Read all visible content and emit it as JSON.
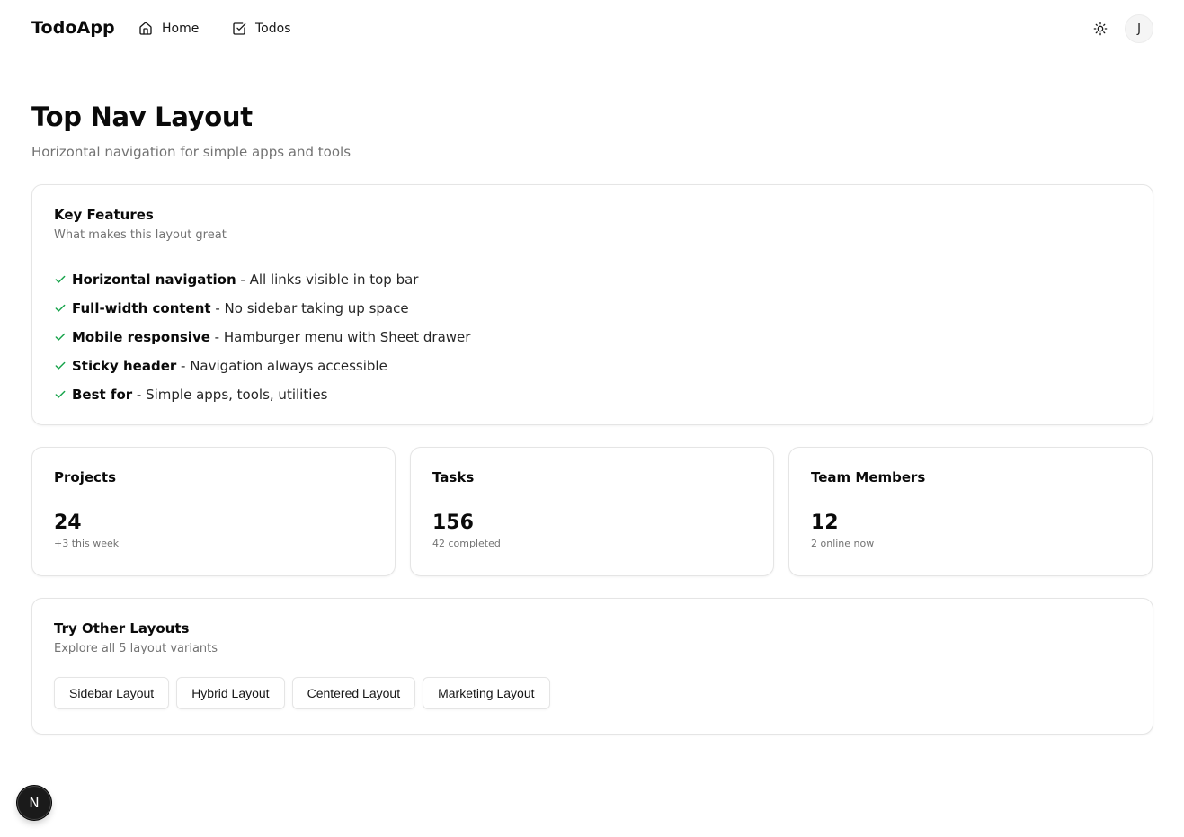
{
  "header": {
    "brand": "TodoApp",
    "nav": [
      {
        "label": "Home",
        "icon": "home-icon"
      },
      {
        "label": "Todos",
        "icon": "checkbox-icon"
      }
    ],
    "theme_icon": "sun-icon",
    "avatar_initial": "J"
  },
  "page": {
    "title": "Top Nav Layout",
    "subtitle": "Horizontal navigation for simple apps and tools"
  },
  "features": {
    "title": "Key Features",
    "description": "What makes this layout great",
    "items": [
      {
        "bold": "Horizontal navigation",
        "rest": " - All links visible in top bar"
      },
      {
        "bold": "Full-width content",
        "rest": " - No sidebar taking up space"
      },
      {
        "bold": "Mobile responsive",
        "rest": " - Hamburger menu with Sheet drawer"
      },
      {
        "bold": "Sticky header",
        "rest": " - Navigation always accessible"
      },
      {
        "bold": "Best for",
        "rest": " - Simple apps, tools, utilities"
      }
    ],
    "check_color": "#16a34a"
  },
  "stats": [
    {
      "title": "Projects",
      "value": "24",
      "note": "+3 this week"
    },
    {
      "title": "Tasks",
      "value": "156",
      "note": "42 completed"
    },
    {
      "title": "Team Members",
      "value": "12",
      "note": "2 online now"
    }
  ],
  "layouts": {
    "title": "Try Other Layouts",
    "description": "Explore all 5 layout variants",
    "buttons": [
      "Sidebar Layout",
      "Hybrid Layout",
      "Centered Layout",
      "Marketing Layout"
    ]
  },
  "dev_badge": {
    "letter": "N"
  }
}
